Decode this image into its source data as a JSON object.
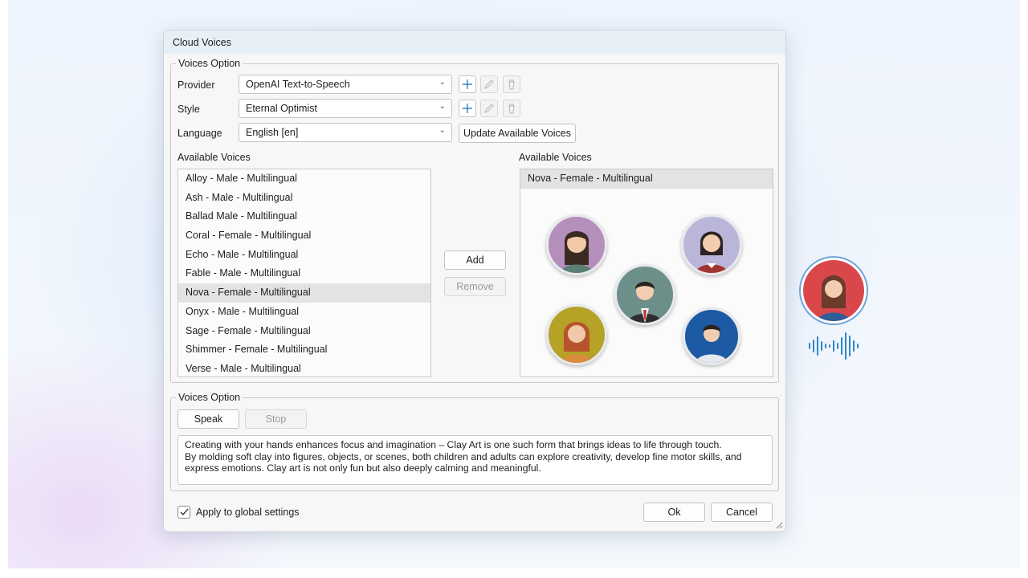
{
  "window": {
    "title": "Cloud Voices"
  },
  "voices_group": {
    "title": "Voices Option",
    "provider": {
      "label": "Provider",
      "value": "OpenAI Text-to-Speech"
    },
    "style": {
      "label": "Style",
      "value": "Eternal Optimist"
    },
    "language": {
      "label": "Language",
      "value": "English [en]",
      "update_button": "Update Available Voices"
    },
    "available_label": "Available Voices",
    "available": [
      "Alloy - Male - Multilingual",
      "Ash - Male - Multilingual",
      "Ballad Male - Multilingual",
      "Coral - Female - Multilingual",
      "Echo - Male - Multilingual",
      "Fable - Male - Multilingual",
      "Nova - Female - Multilingual",
      "Onyx - Male - Multilingual",
      "Sage - Female - Multilingual",
      "Shimmer - Female - Multilingual",
      "Verse - Male - Multilingual"
    ],
    "selected_index": 6,
    "add_button": "Add",
    "remove_button": "Remove",
    "chosen_label": "Available Voices",
    "chosen": [
      "Nova - Female - Multilingual"
    ]
  },
  "speak_group": {
    "title": "Voices Option",
    "speak_button": "Speak",
    "stop_button": "Stop",
    "text_lines": [
      "Creating with your hands enhances focus and imagination – Clay Art is one such form that brings ideas to life through touch.",
      "By molding soft clay into figures, objects, or scenes, both children and adults can explore creativity, develop fine motor skills, and",
      "express emotions. Clay art is not only fun but also deeply calming and meaningful."
    ]
  },
  "footer": {
    "apply_label": "Apply to global settings",
    "apply_checked": true,
    "ok_button": "Ok",
    "cancel_button": "Cancel"
  },
  "colors": {
    "accent": "#2f86c7",
    "titlebar": "#e6f0f6",
    "selection": "#e3e3e3"
  }
}
